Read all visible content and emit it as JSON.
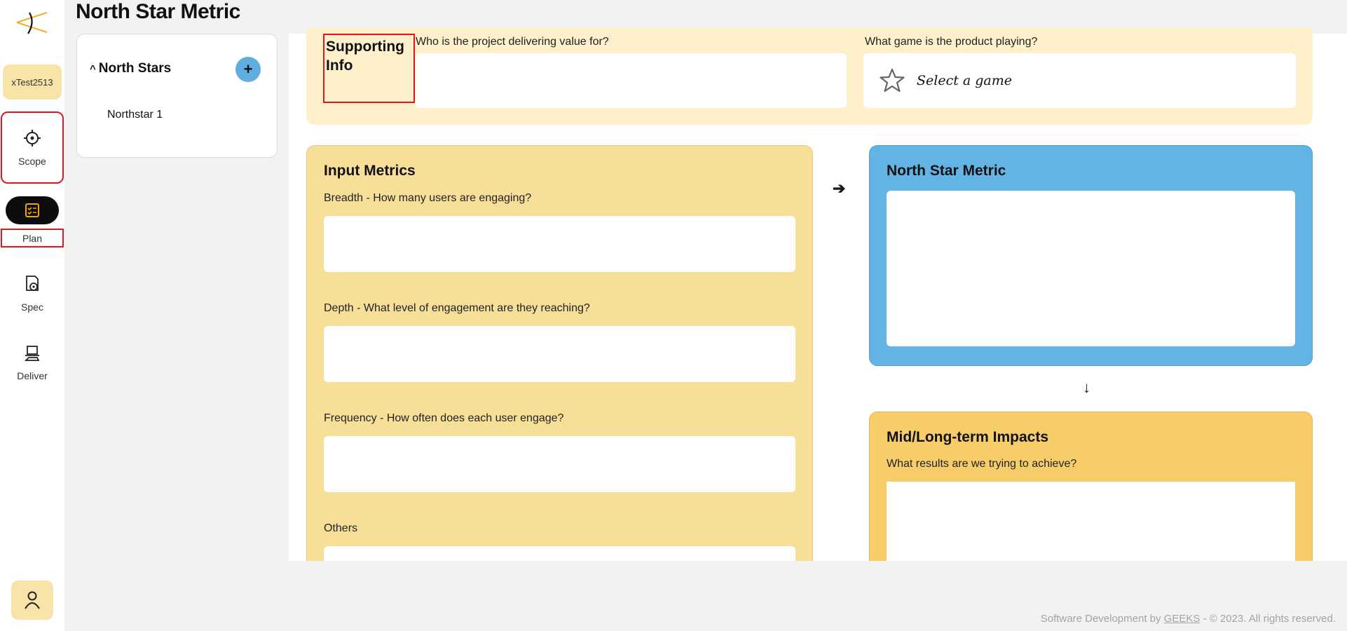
{
  "app": {
    "page_title": "North Star Metric",
    "project_chip": "xTest2513"
  },
  "nav": {
    "scope": "Scope",
    "plan": "Plan",
    "spec": "Spec",
    "deliver": "Deliver"
  },
  "north_stars": {
    "header": "North Stars",
    "items": [
      "Northstar 1"
    ]
  },
  "supporting_info": {
    "label": "Supporting Info",
    "who_question": "Who is the project delivering value for?",
    "who_value": "",
    "game_question": "What game is the product playing?",
    "game_value": "Select a game"
  },
  "input_metrics": {
    "title": "Input Metrics",
    "breadth_label": "Breadth - How many users are engaging?",
    "depth_label": "Depth - What level of engagement are they reaching?",
    "frequency_label": "Frequency - How often does each user engage?",
    "others_label": "Others"
  },
  "north_star_metric": {
    "title": "North Star Metric"
  },
  "impacts": {
    "title": "Mid/Long-term Impacts",
    "question": "What results are we trying to achieve?"
  },
  "arrows": {
    "right": "➔",
    "down": "↓"
  },
  "footer": {
    "prefix": "Software Development by ",
    "link": "GEEKS",
    "suffix": " - © 2023. All rights reserved."
  },
  "colors": {
    "accent_yellow": "#f8df98",
    "accent_blue": "#63b4e4",
    "impact_yellow": "#f6cd68",
    "highlight_red": "#e0161e"
  }
}
